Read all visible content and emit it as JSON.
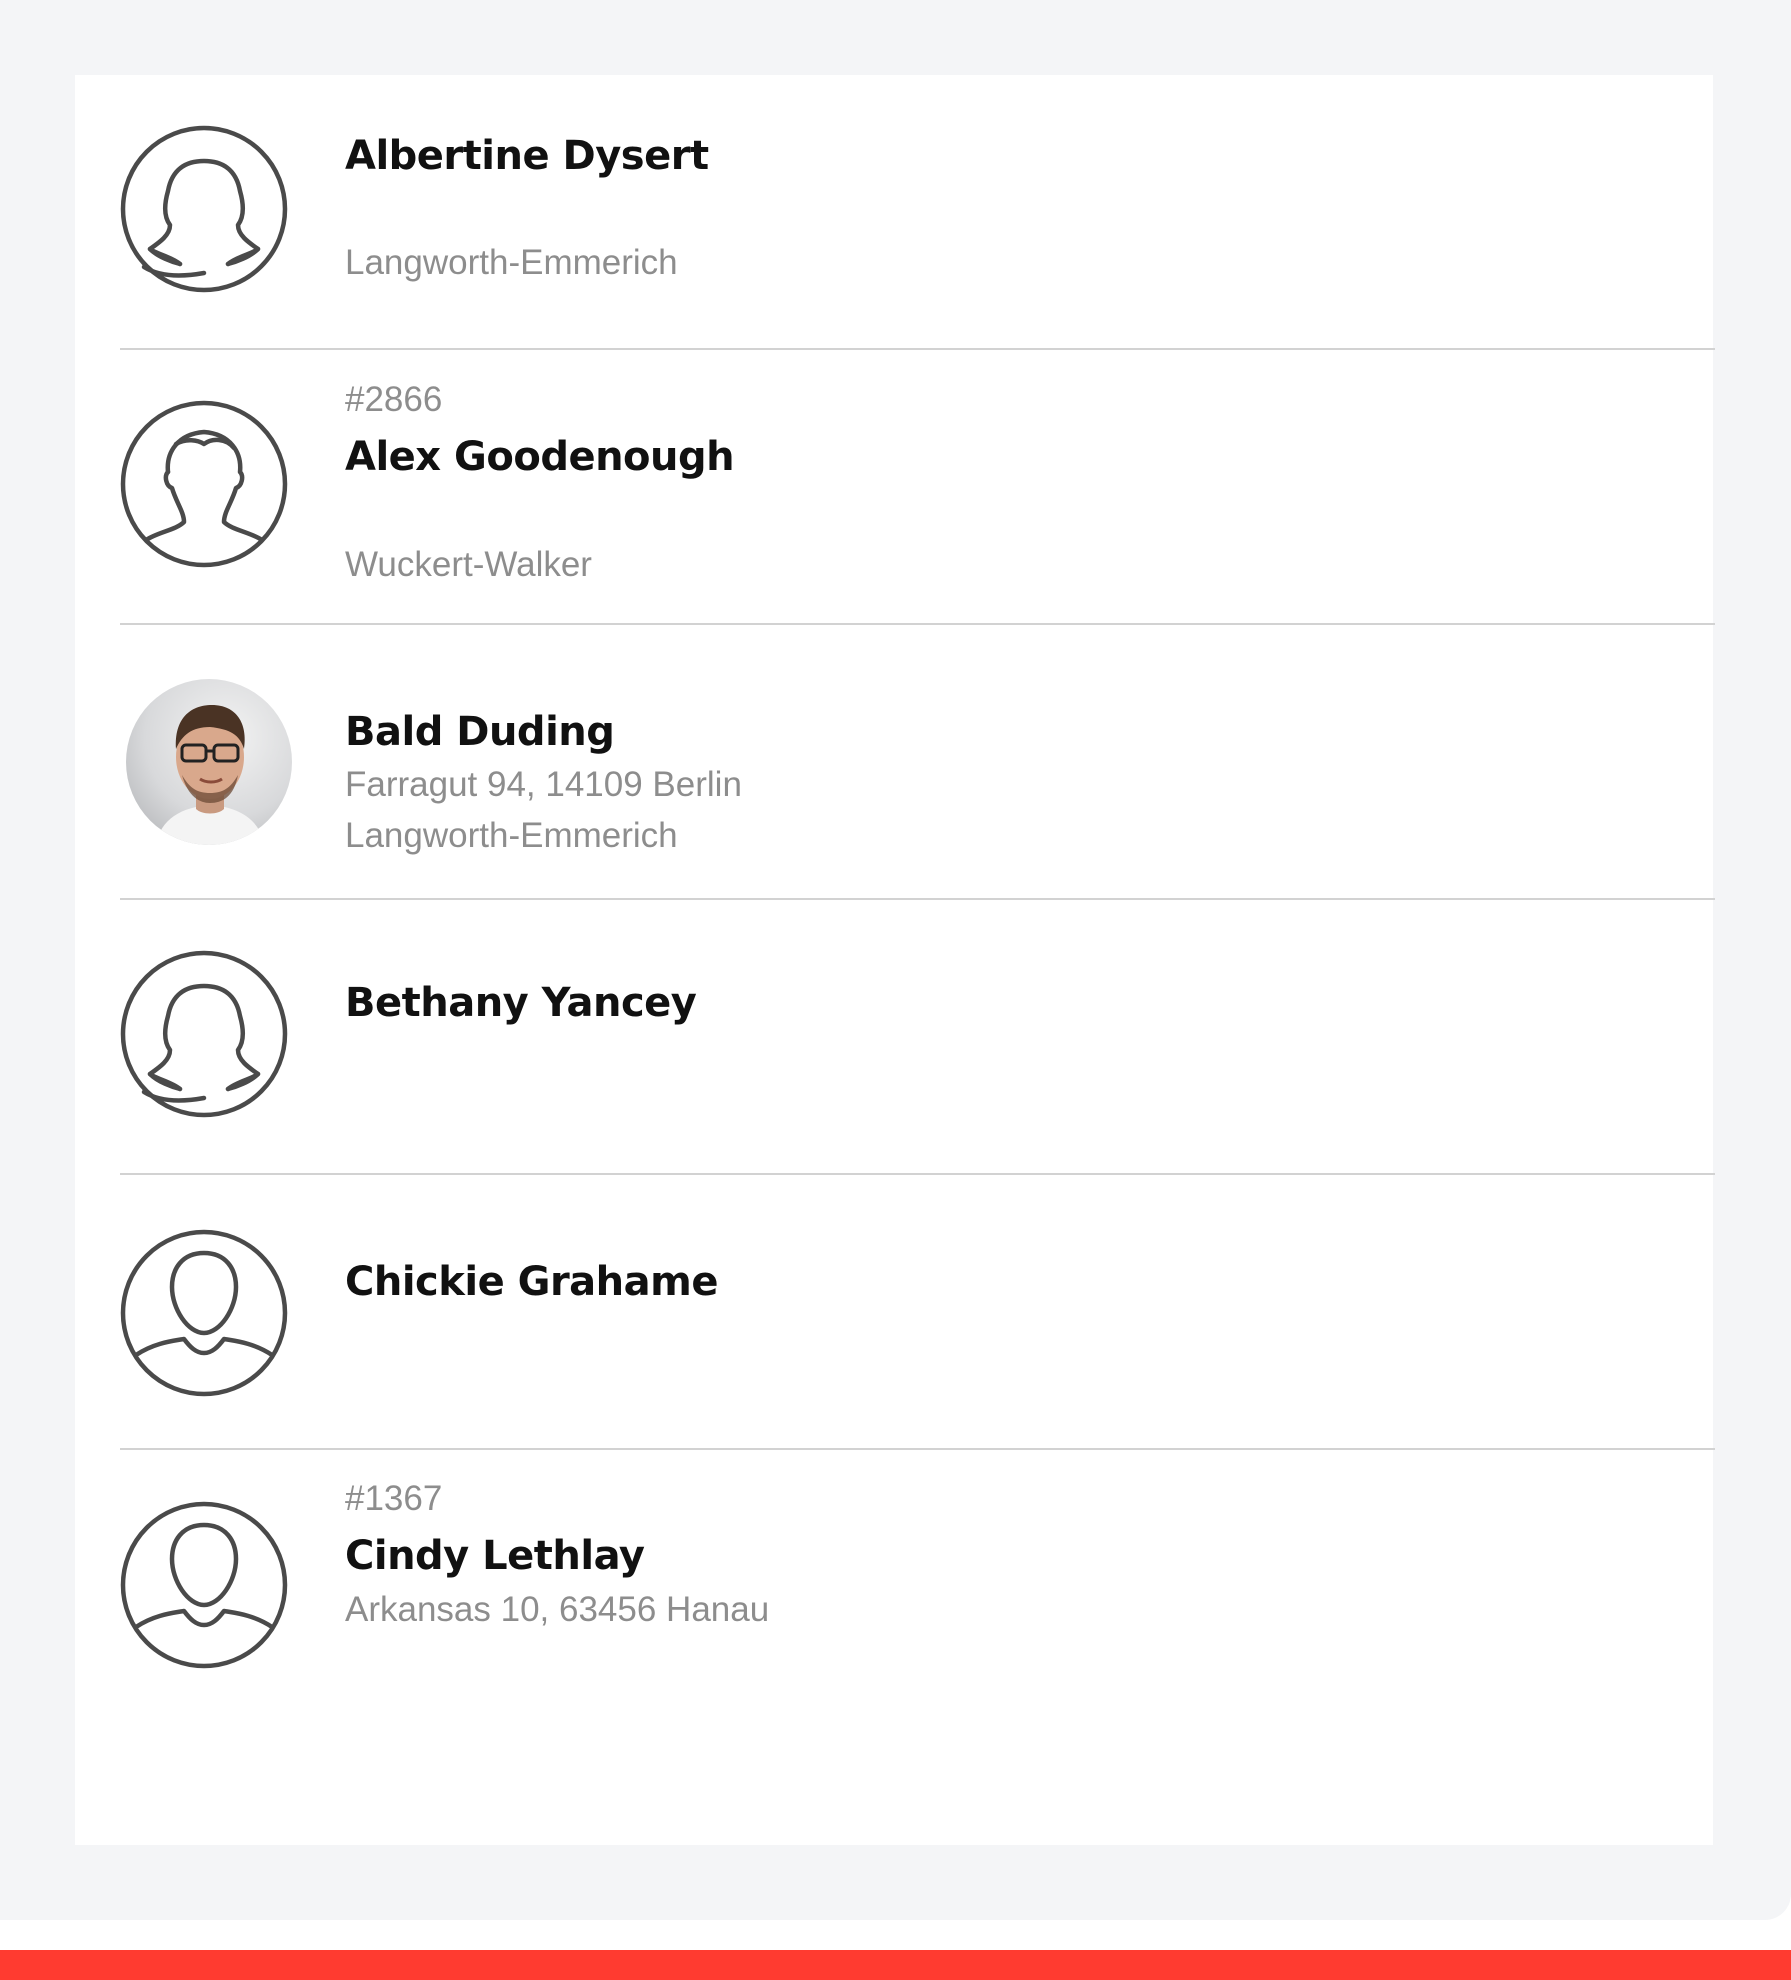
{
  "contacts": [
    {
      "id_label": "",
      "name": "Albertine Dysert",
      "address": "",
      "company": "Langworth-Emmerich",
      "avatar": "female-placeholder-icon"
    },
    {
      "id_label": "#2866",
      "name": "Alex Goodenough",
      "address": "",
      "company": "Wuckert-Walker",
      "avatar": "male-placeholder-icon"
    },
    {
      "id_label": "",
      "name": "Bald Duding",
      "address": "Farragut 94, 14109 Berlin",
      "company": "Langworth-Emmerich",
      "avatar": "profile-photo"
    },
    {
      "id_label": "",
      "name": "Bethany Yancey",
      "address": "",
      "company": "",
      "avatar": "female-placeholder-icon"
    },
    {
      "id_label": "",
      "name": "Chickie Grahame",
      "address": "",
      "company": "",
      "avatar": "neutral-placeholder-icon"
    },
    {
      "id_label": "#1367",
      "name": "Cindy Lethlay",
      "address": "Arkansas 10, 63456 Hanau",
      "company": "",
      "avatar": "neutral-placeholder-icon"
    }
  ],
  "colors": {
    "background": "#f4f5f7",
    "card": "#ffffff",
    "divider": "#d2d2d2",
    "name_text": "#111111",
    "secondary_text": "#8d8d8d",
    "icon_stroke": "#4a4a4a",
    "accent_bar": "#ff3b30"
  }
}
